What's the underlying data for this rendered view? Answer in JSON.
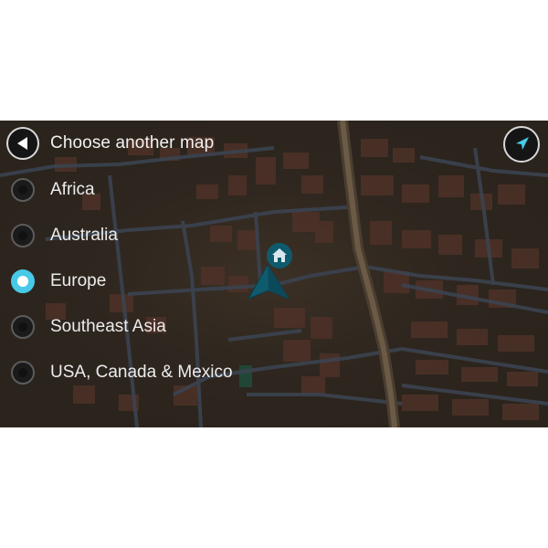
{
  "header": {
    "title": "Choose another map",
    "back_icon": "back-arrow-icon",
    "nav_icon": "navigation-arrow-icon"
  },
  "options": [
    {
      "label": "Africa",
      "selected": false
    },
    {
      "label": "Australia",
      "selected": false
    },
    {
      "label": "Europe",
      "selected": true
    },
    {
      "label": "Southeast Asia",
      "selected": false
    },
    {
      "label": "USA, Canada & Mexico",
      "selected": false
    }
  ],
  "map": {
    "home_icon": "home-icon",
    "position_icon": "current-position-arrow-icon"
  },
  "colors": {
    "accent": "#49c9e8",
    "map_background": "#2b241d",
    "marker": "#0f5b6e"
  }
}
